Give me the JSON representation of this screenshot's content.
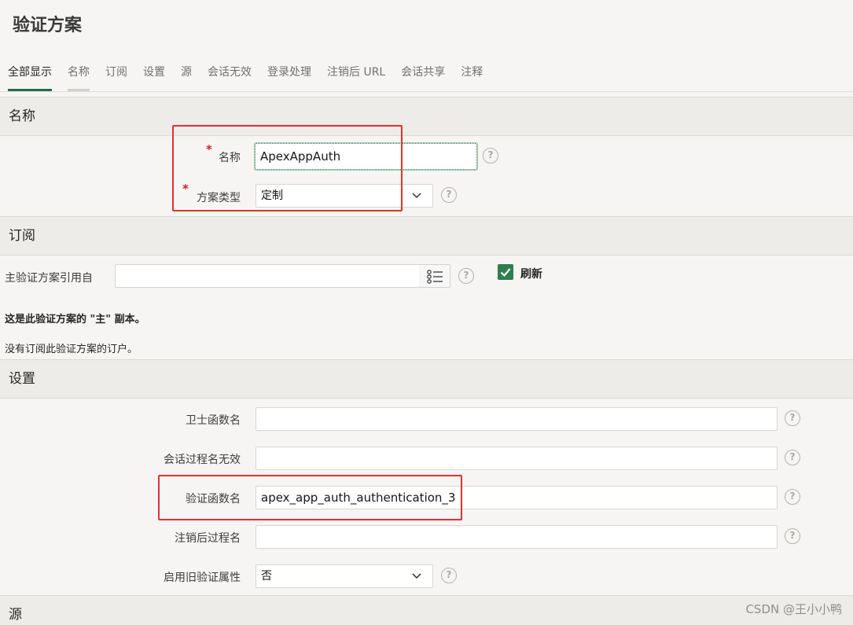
{
  "page": {
    "title": "验证方案"
  },
  "tabs": [
    {
      "label": "全部显示",
      "active": true
    },
    {
      "label": "名称"
    },
    {
      "label": "订阅"
    },
    {
      "label": "设置"
    },
    {
      "label": "源"
    },
    {
      "label": "会话无效"
    },
    {
      "label": "登录处理"
    },
    {
      "label": "注销后 URL"
    },
    {
      "label": "会话共享"
    },
    {
      "label": "注释"
    }
  ],
  "sections": {
    "name": {
      "heading": "名称",
      "name_label": "名称",
      "name_value": "ApexAppAuth",
      "type_label": "方案类型",
      "type_value": "定制",
      "required_mark": "*"
    },
    "subscription": {
      "heading": "订阅",
      "master_label": "主验证方案引用自",
      "master_value": "",
      "refresh_label": "刷新",
      "refresh_checked": true,
      "master_copy_text": "这是此验证方案的 \"主\" 副本。",
      "no_subscribers_text": "没有订阅此验证方案的订户。"
    },
    "settings": {
      "heading": "设置",
      "sentry_label": "卫士函数名",
      "sentry_value": "",
      "invalid_session_label": "会话过程名无效",
      "invalid_session_value": "",
      "auth_function_label": "验证函数名",
      "auth_function_value": "apex_app_auth_authentication_3",
      "post_logout_label": "注销后过程名",
      "post_logout_value": "",
      "legacy_label": "启用旧验证属性",
      "legacy_value": "否"
    },
    "source": {
      "heading": "源"
    }
  },
  "icons": {
    "help": "help-circle-icon",
    "dropdown": "chevron-down-icon",
    "list": "list-icon",
    "check": "checkmark-icon"
  },
  "help_glyph": "?",
  "colors": {
    "accent": "#2e7d4f",
    "highlight": "#e53030",
    "required": "#c4262e"
  },
  "watermark": "CSDN @王小小鸭"
}
